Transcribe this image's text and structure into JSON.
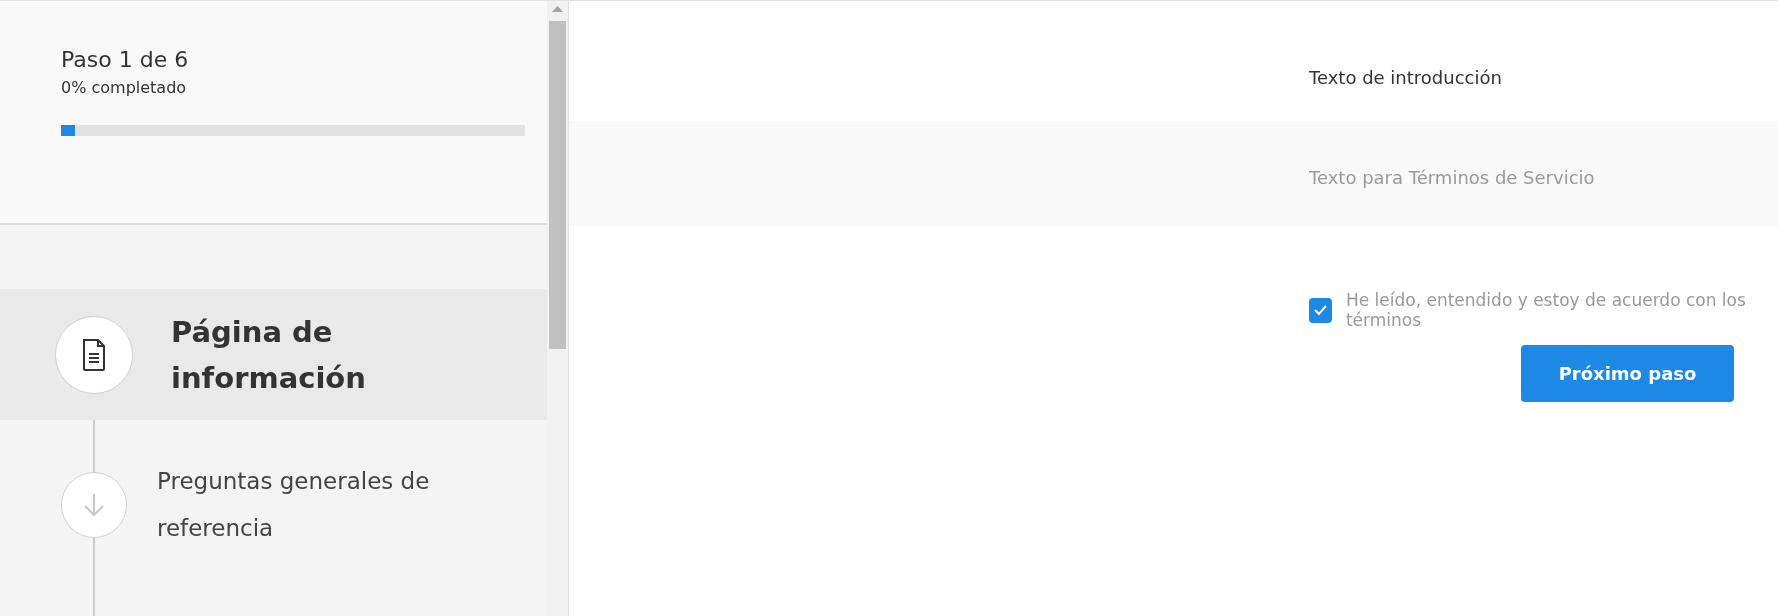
{
  "progress": {
    "title": "Paso 1 de 6",
    "subtitle": "0% completado",
    "level": 0.03
  },
  "steps": [
    {
      "title": "Página de información",
      "kind": "document",
      "selected": true
    },
    {
      "title": "Preguntas generales de referencia",
      "kind": "pending",
      "selected": false
    }
  ],
  "intro": "Texto de introducción",
  "terms": "Texto para Términos de Servicio",
  "agreement": {
    "label": "He leído, entendido y estoy de acuerdo con los términos",
    "checked": true
  },
  "next_button": "Próximo paso"
}
